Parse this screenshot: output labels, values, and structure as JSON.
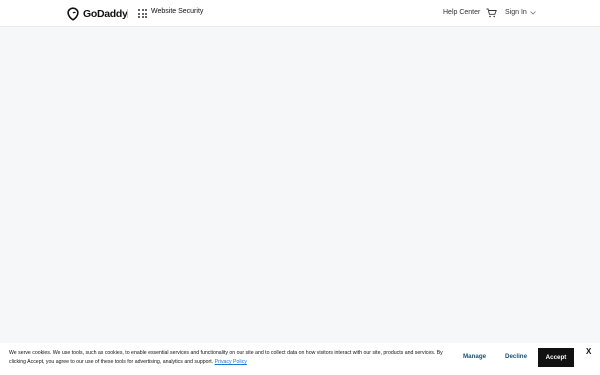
{
  "header": {
    "logo_text": "GoDaddy",
    "product_label": "Website Security",
    "help_label": "Help Center",
    "signin_label": "Sign In",
    "icons": [
      "godaddy-logo-icon",
      "apps-grid-icon",
      "cart-icon",
      "chevron-down-icon"
    ]
  },
  "cookie": {
    "text": "We serve cookies. We use tools, such as cookies, to enable essential services and functionality on our site and to collect data on how visitors interact with our site, products and services. By clicking Accept, you agree to our use of these tools for advertising, analytics and support.",
    "privacy_link": "Privacy Policy",
    "manage_label": "Manage",
    "decline_label": "Decline",
    "accept_label": "Accept",
    "close_label": "X"
  },
  "colors": {
    "page_background": "#f5f7f8",
    "accent_link": "#1976d2",
    "button_text": "#1b4f72",
    "accept_background": "#111111"
  }
}
